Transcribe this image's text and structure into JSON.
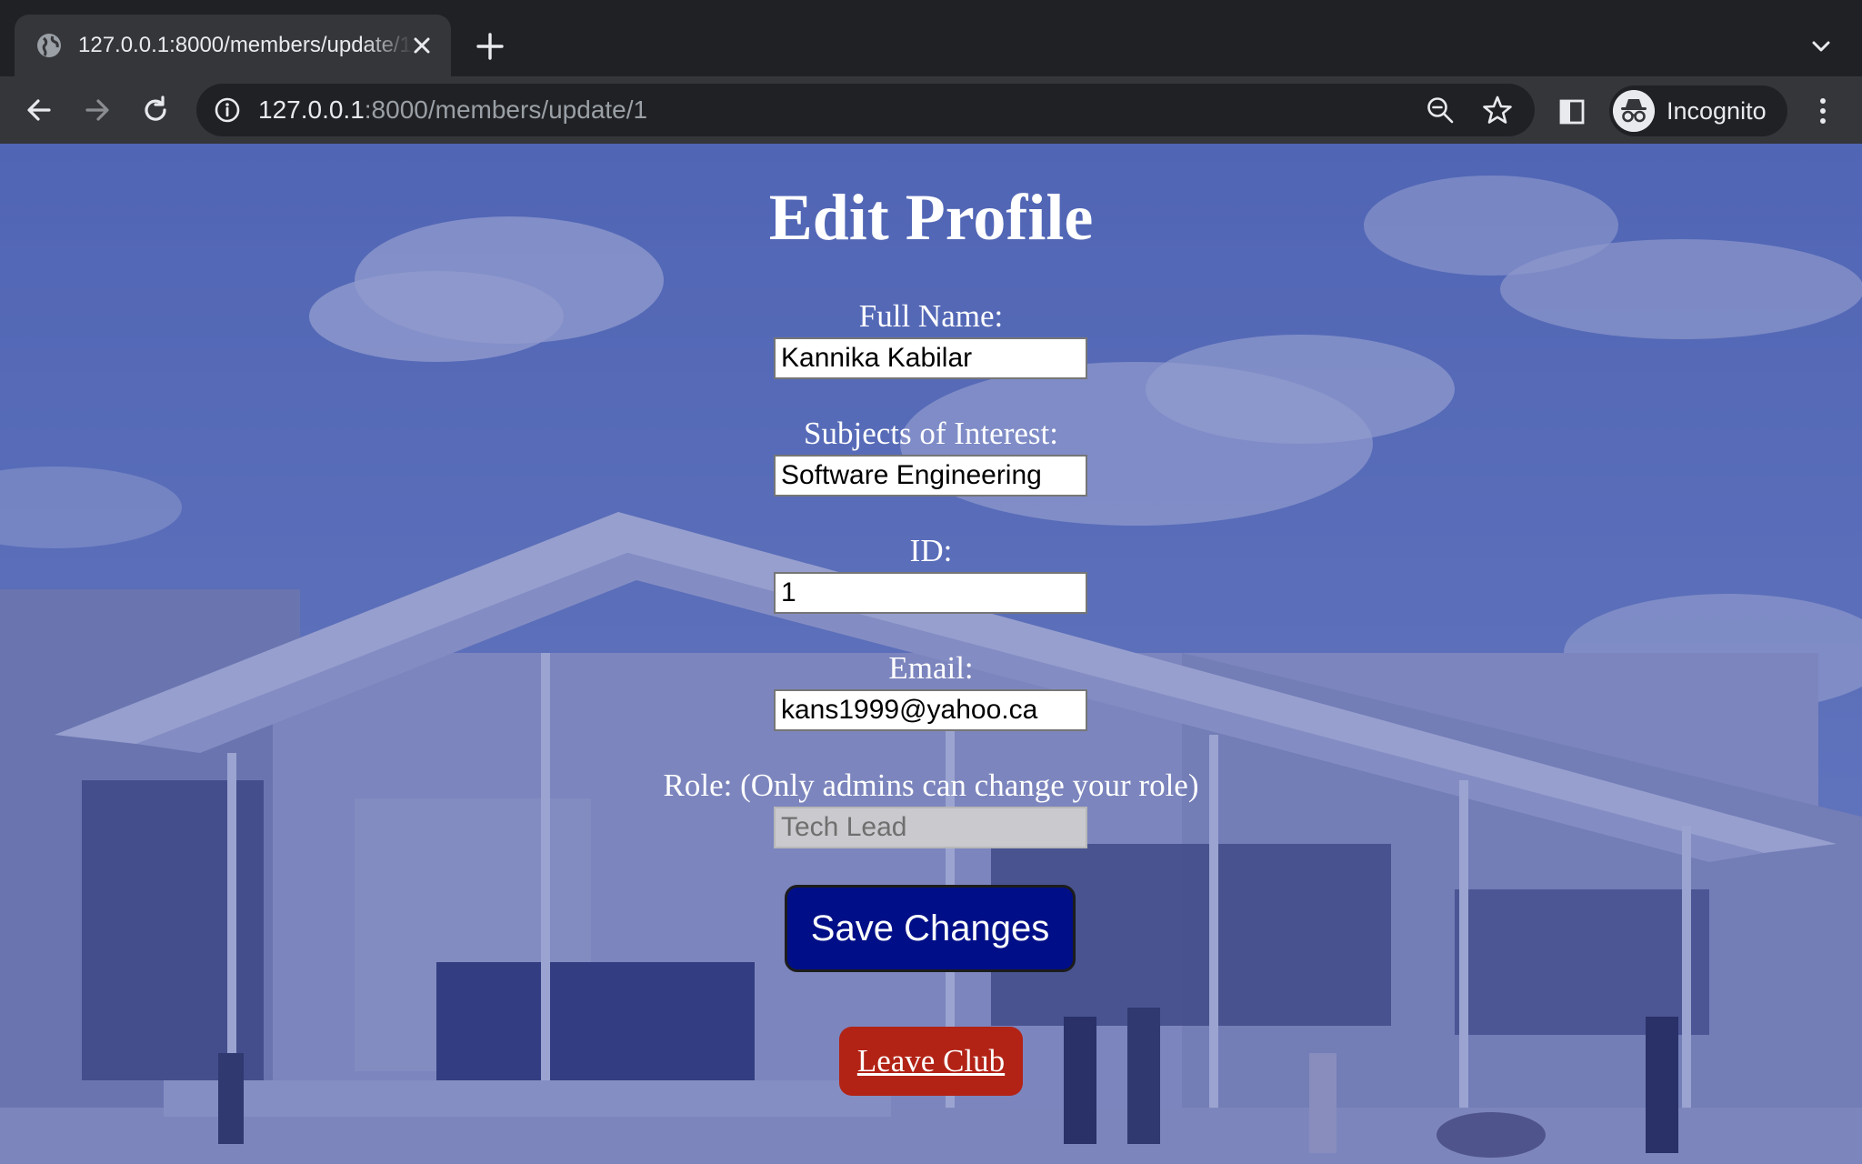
{
  "browser": {
    "tab": {
      "title": "127.0.0.1:8000/members/update/1"
    },
    "address_bar": {
      "host": "127.0.0.1",
      "path": ":8000/members/update/1"
    },
    "profile_label": "Incognito"
  },
  "page": {
    "title": "Edit Profile",
    "fields": {
      "full_name": {
        "label": "Full Name:",
        "value": "Kannika Kabilar"
      },
      "subjects": {
        "label": "Subjects of Interest:",
        "value": "Software Engineering"
      },
      "id": {
        "label": "ID:",
        "value": "1"
      },
      "email": {
        "label": "Email:",
        "value": "kans1999@yahoo.ca"
      },
      "role": {
        "label": "Role: (Only admins can change your role)",
        "placeholder": "Tech Lead"
      }
    },
    "save_label": "Save Changes",
    "leave_label": "Leave Club"
  },
  "colors": {
    "chrome_dark": "#202124",
    "chrome_toolbar": "#35363a",
    "overlay_tint": "#2434968a",
    "save_button": "#000f87",
    "leave_button": "#b22316"
  }
}
